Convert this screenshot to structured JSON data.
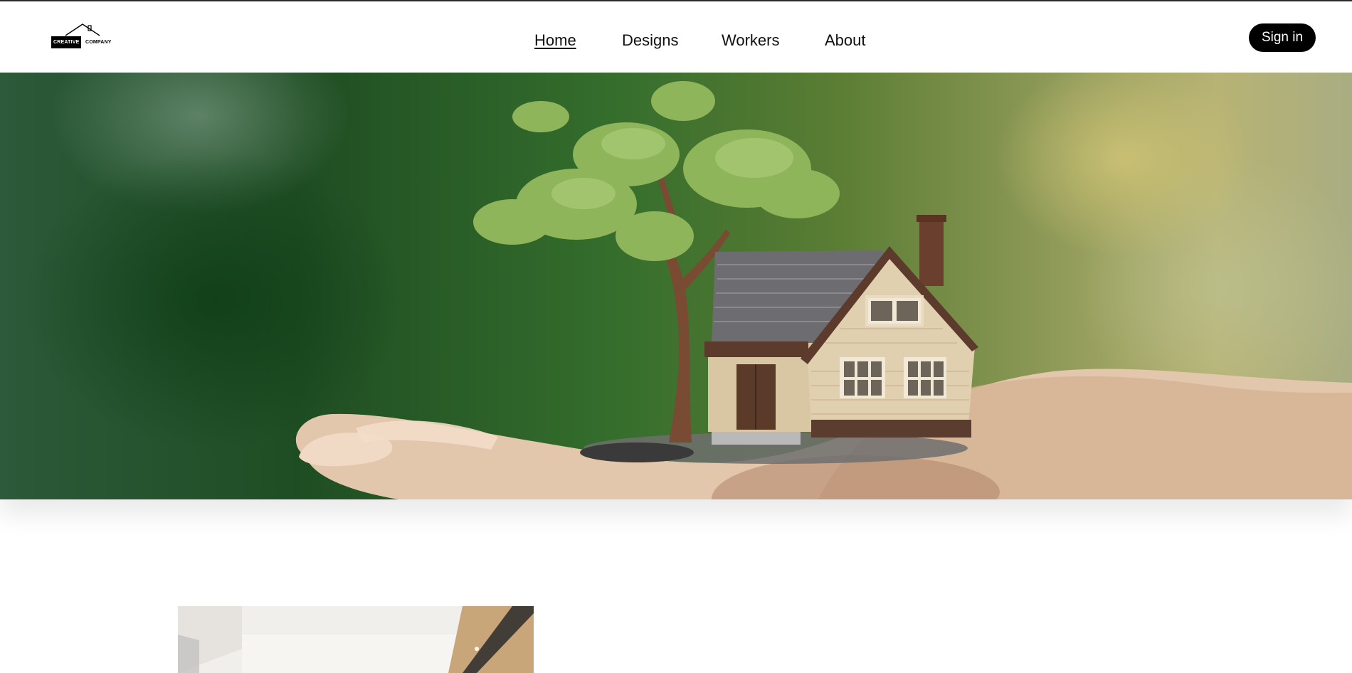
{
  "brand": {
    "logo_text_1": "CREATIVE",
    "logo_text_2": "COMPANY"
  },
  "nav": {
    "items": [
      {
        "label": "Home",
        "active": true
      },
      {
        "label": "Designs",
        "active": false
      },
      {
        "label": "Workers",
        "active": false
      },
      {
        "label": "About",
        "active": false
      }
    ]
  },
  "auth": {
    "signin_label": "Sign in"
  },
  "hero": {
    "image_subject": "house-in-hand-photo"
  },
  "colors": {
    "accent": "#000000",
    "background": "#ffffff",
    "text": "#111111"
  }
}
